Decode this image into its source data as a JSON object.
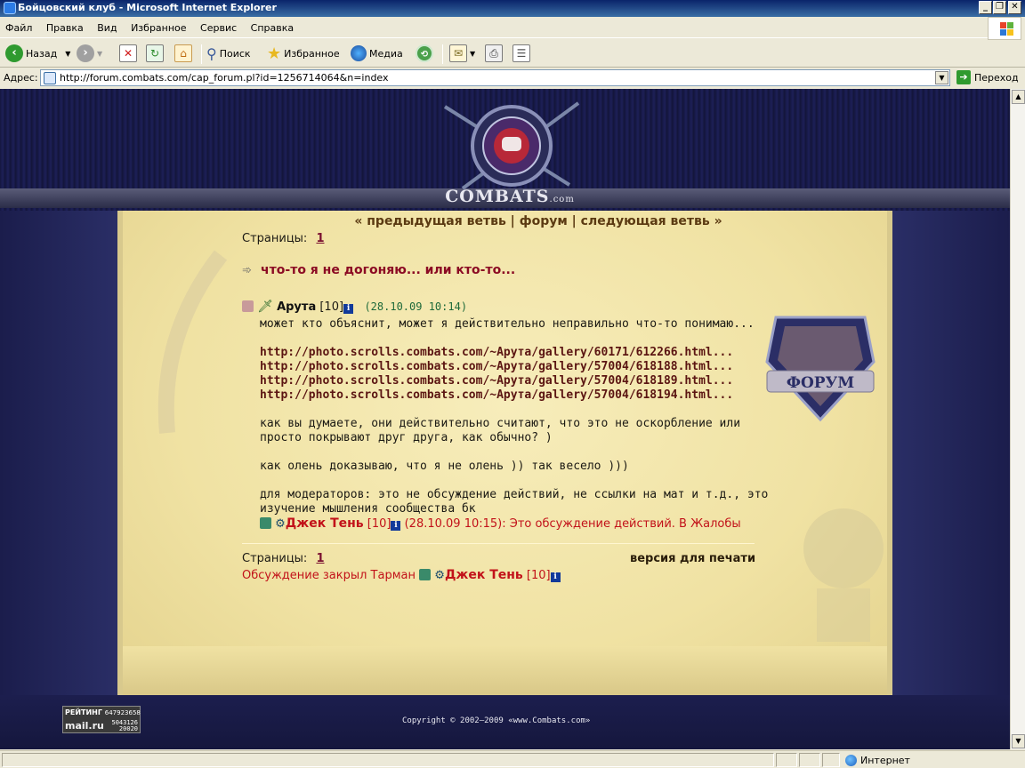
{
  "window": {
    "title": "Бойцовский клуб - Microsoft Internet Explorer",
    "buttons": {
      "minimize": "_",
      "maximize": "❐",
      "close": "✕"
    }
  },
  "menu": [
    "Файл",
    "Правка",
    "Вид",
    "Избранное",
    "Сервис",
    "Справка"
  ],
  "toolbar": {
    "back": "Назад",
    "search": "Поиск",
    "favorites": "Избранное",
    "media": "Медиа"
  },
  "address": {
    "label": "Адрес:",
    "url": "http://forum.combats.com/cap_forum.pl?id=1256714064&n=index",
    "go": "Переход"
  },
  "site": {
    "logo": "COMBATS",
    "logo_suffix": ".com",
    "badge": "ФОРУМ"
  },
  "forum": {
    "nav": {
      "prev": "« предыдущая ветвь",
      "sep1": " | ",
      "forum": "форум",
      "sep2": " | ",
      "next": "следующая ветвь »"
    },
    "pages_label": "Страницы:",
    "page_num": "1",
    "topic_title": "что-то я не догоняю... или кто-то...",
    "post": {
      "author": "Арута",
      "level": "[10]",
      "date": "(28.10.09 10:14)",
      "lines": [
        {
          "text": "может кто объяснит, может я действительно неправильно что-то понимаю...",
          "link": false
        },
        {
          "text": "",
          "link": false
        },
        {
          "text": "http://photo.scrolls.combats.com/~Арута/gallery/60171/612266.html...",
          "link": true
        },
        {
          "text": "http://photo.scrolls.combats.com/~Арута/gallery/57004/618188.html...",
          "link": true
        },
        {
          "text": "http://photo.scrolls.combats.com/~Арута/gallery/57004/618189.html...",
          "link": true
        },
        {
          "text": "http://photo.scrolls.combats.com/~Арута/gallery/57004/618194.html...",
          "link": true
        },
        {
          "text": "",
          "link": false
        },
        {
          "text": "как вы думаете, они действительно считают, что это не оскорбление или",
          "link": false
        },
        {
          "text": "просто покрывают друг друга, как обычно? )",
          "link": false
        },
        {
          "text": "",
          "link": false
        },
        {
          "text": "как олень доказываю, что я не олень )) так весело )))",
          "link": false
        },
        {
          "text": "",
          "link": false
        },
        {
          "text": "для модераторов: это не обсуждение действий, не ссылки на мат и т.д., это",
          "link": false
        },
        {
          "text": "изучение мышления сообщества бк",
          "link": false
        }
      ],
      "reply": {
        "author": "Джек Тень",
        "level": "[10]",
        "text": "(28.10.09 10:15): Это обсуждение действий. В Жалобы"
      }
    },
    "print_version": "версия для печати",
    "closed_by": "Обсуждение закрыл Тарман",
    "closed_author": "Джек Тень",
    "closed_level": "[10]"
  },
  "footer": {
    "copyright": "Copyright © 2002–2009 «www.Combats.com»",
    "counter": {
      "label": "РЕЙТИНГ",
      "num1": "647923658",
      "brand": "mail.ru",
      "num2": "5043126",
      "num3": "20020"
    }
  },
  "status": {
    "zone": "Интернет"
  }
}
